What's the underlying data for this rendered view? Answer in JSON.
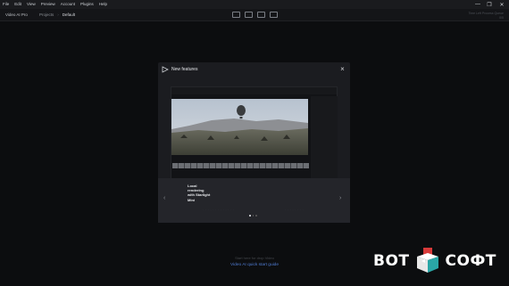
{
  "menubar": {
    "items": [
      "File",
      "Edit",
      "View",
      "Preview",
      "Account",
      "Plugins",
      "Help"
    ]
  },
  "window_controls": {
    "minimize": "—",
    "maximize": "❐",
    "close": "✕"
  },
  "header": {
    "app_title": "Video AI Pro",
    "breadcrumb": {
      "parent": "Projects",
      "separator": "›",
      "current": "Default"
    },
    "view_buttons": [
      "single-view-icon",
      "split-view-icon",
      "side-by-side-icon",
      "compare-icon"
    ],
    "right_line_1": "Time Left   Process Queue",
    "right_line_2": "0/0"
  },
  "modal": {
    "title": "New features",
    "close_label": "×",
    "feature_caption": "Local rendering with Starlight Mini",
    "prev_arrow": "‹",
    "next_arrow": "›",
    "page_count": 3,
    "active_page": 1
  },
  "main": {
    "empty_text": "Start here for drop Video",
    "guide_link": "Video AI quick start guide"
  },
  "watermark": {
    "left_text": "ВОТ",
    "right_text": "СОФТ"
  },
  "colors": {
    "background": "#0f1012",
    "modal": "#1b1c20",
    "link": "#4f7bd1",
    "watermark_red": "#d83a3a",
    "watermark_teal": "#2aa6a6"
  }
}
